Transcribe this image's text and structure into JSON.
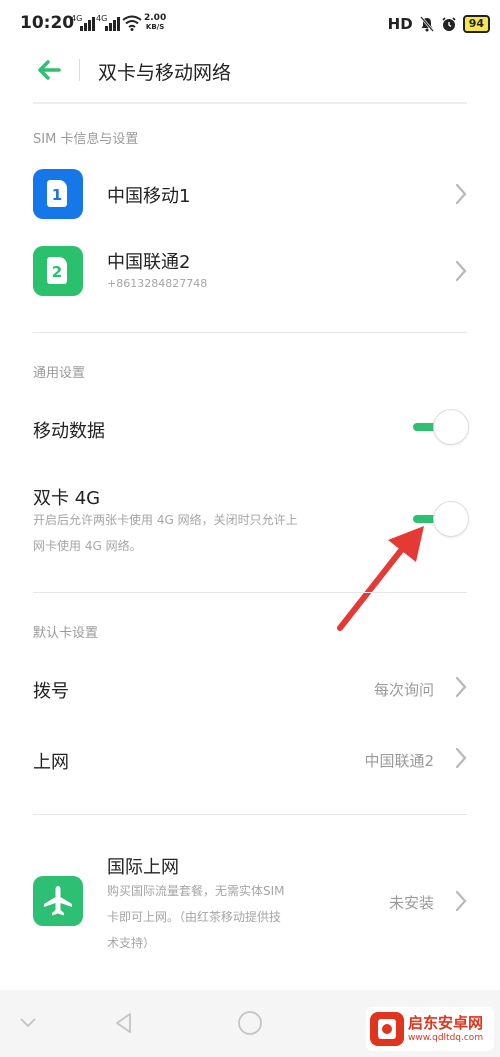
{
  "status_bar": {
    "time": "10:20",
    "net1": "4G",
    "net2": "4G",
    "speed_value": "2.00",
    "speed_unit": "KB/S",
    "hd": "HD",
    "battery": "94"
  },
  "header": {
    "title": "双卡与移动网络"
  },
  "sim_section": {
    "heading": "SIM 卡信息与设置",
    "sims": [
      {
        "slot": "1",
        "name": "中国移动1",
        "number": ""
      },
      {
        "slot": "2",
        "name": "中国联通2",
        "number": "+8613284827748"
      }
    ]
  },
  "general_section": {
    "heading": "通用设置",
    "mobile_data": {
      "label": "移动数据",
      "enabled": true
    },
    "dual_4g": {
      "label": "双卡 4G",
      "desc_line1": "开启后允许两张卡使用 4G 网络，关闭时只允许上",
      "desc_line2": "网卡使用 4G 网络。",
      "enabled": true
    }
  },
  "default_section": {
    "heading": "默认卡设置",
    "dial": {
      "label": "拨号",
      "value": "每次询问"
    },
    "internet": {
      "label": "上网",
      "value": "中国联通2"
    }
  },
  "international": {
    "title": "国际上网",
    "desc_line1": "购买国际流量套餐，无需实体SIM",
    "desc_line2": "卡即可上网。（由红茶移动提供技",
    "desc_line3": "术支持）",
    "status": "未安装"
  },
  "watermark": {
    "name": "启东安卓网",
    "url": "www.qdltdq.com"
  },
  "colors": {
    "accent_green": "#2fbf71",
    "sim1_blue": "#1677e8",
    "sim2_green": "#2bc06c",
    "arrow_red": "#e53935"
  }
}
